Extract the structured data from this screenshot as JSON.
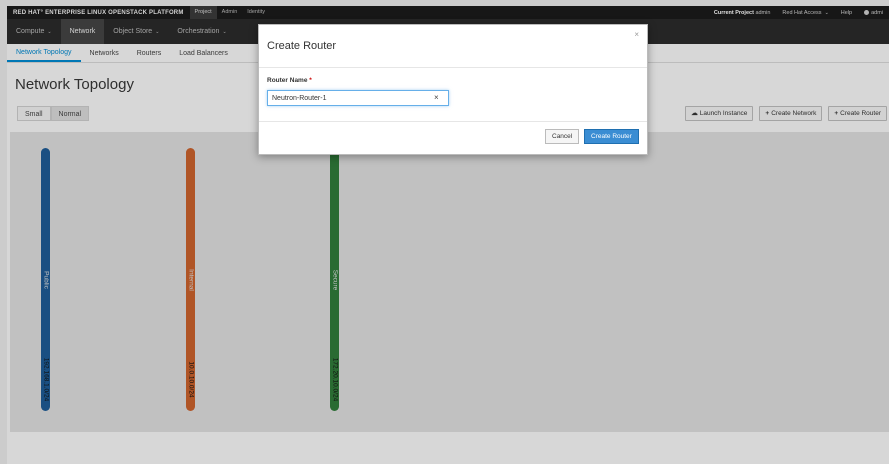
{
  "brand": "RED HAT° ENTERPRISE LINUX OPENSTACK PLATFORM",
  "top_nav": [
    {
      "label": "Project"
    },
    {
      "label": "Admin"
    },
    {
      "label": "Identity"
    }
  ],
  "top_right": {
    "current_project_prefix": "Current Project",
    "current_project": "admin",
    "red_hat_access": "Red Hat Access",
    "help": "Help",
    "user": "admi"
  },
  "sub_nav": [
    {
      "label": "Compute",
      "has_caret": true
    },
    {
      "label": "Network",
      "has_caret": false
    },
    {
      "label": "Object Store",
      "has_caret": true
    },
    {
      "label": "Orchestration",
      "has_caret": true
    }
  ],
  "third_nav": [
    {
      "label": "Network Topology"
    },
    {
      "label": "Networks"
    },
    {
      "label": "Routers"
    },
    {
      "label": "Load Balancers"
    }
  ],
  "page": {
    "title": "Network Topology",
    "size_small": "Small",
    "size_normal": "Normal",
    "launch_instance": "Launch Instance",
    "create_network": "Create Network",
    "create_router": "Create Router"
  },
  "networks": [
    {
      "name": "Public",
      "cidr": "192.168.1.0/24",
      "color": "#1e5b94"
    },
    {
      "name": "Internal",
      "cidr": "10.0.10.0/24",
      "color": "#c9612c"
    },
    {
      "name": "Secure",
      "cidr": "172.20.10.0/24",
      "color": "#2f7a3a"
    }
  ],
  "modal": {
    "title": "Create Router",
    "close_glyph": "×",
    "field_label": "Router Name",
    "required_mark": "*",
    "router_name_value": "Neutron-Router-1",
    "clear_glyph": "×",
    "cancel_label": "Cancel",
    "submit_label": "Create Router"
  },
  "colors": {
    "accent": "#0088ce",
    "primary_button": "#3a8dd3"
  }
}
